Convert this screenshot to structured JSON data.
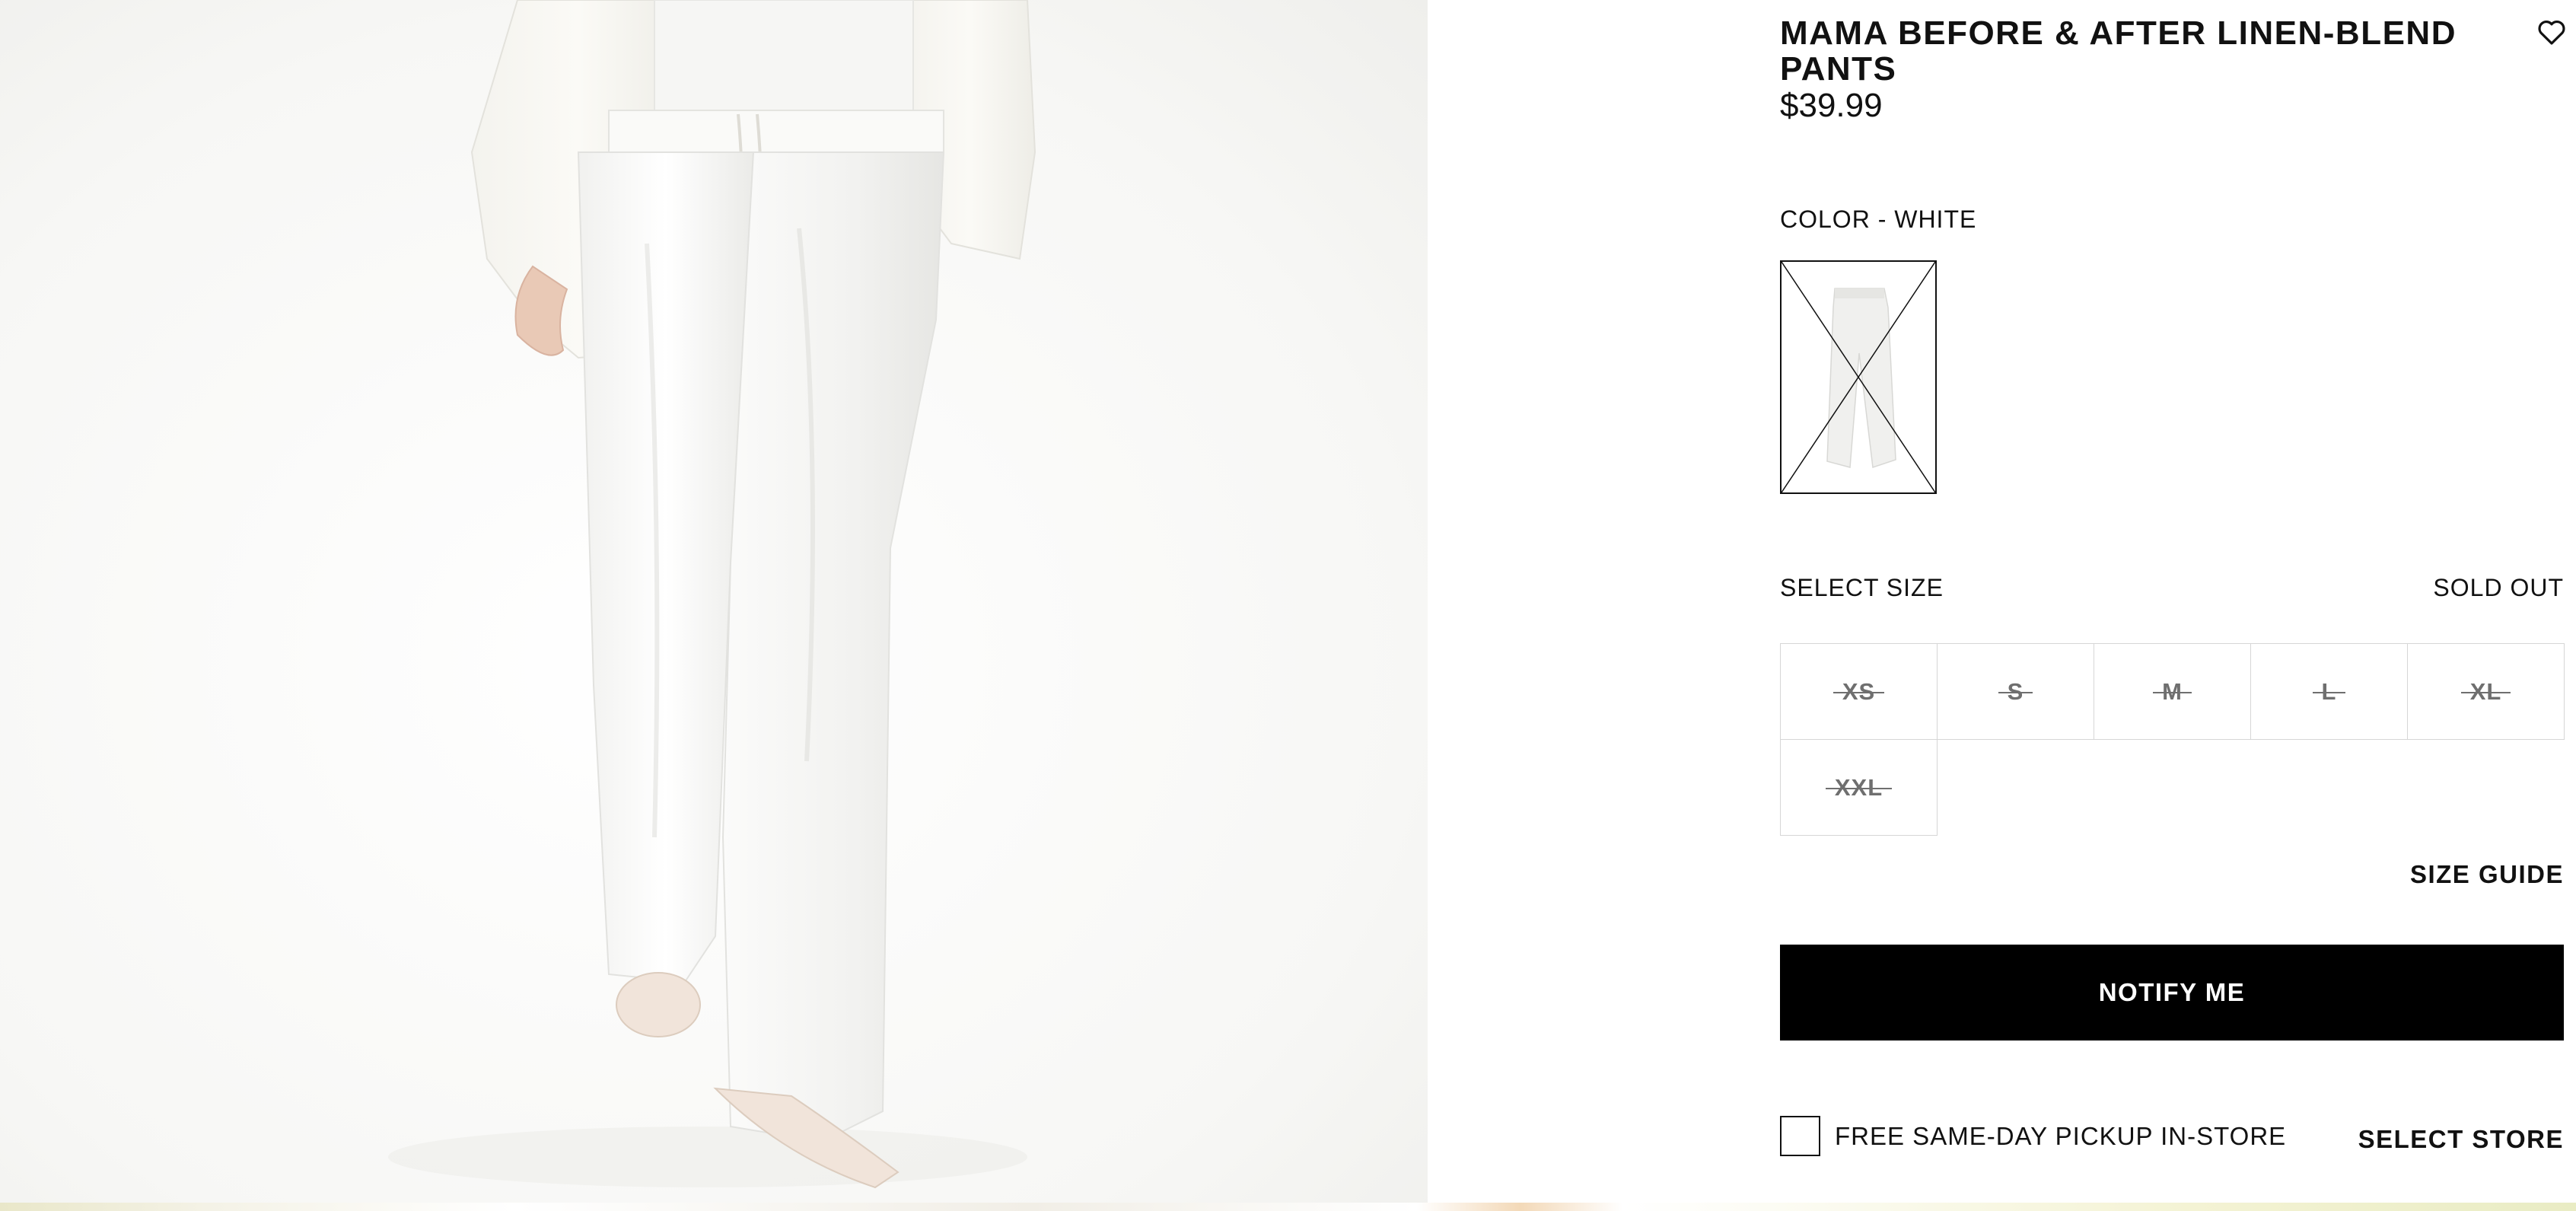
{
  "product": {
    "title": "MAMA BEFORE & AFTER LINEN-BLEND PANTS",
    "price": "$39.99"
  },
  "icons": {
    "wishlist": "heart-outline-icon"
  },
  "color": {
    "label": "COLOR - WHITE",
    "selected_swatch": "white"
  },
  "size": {
    "label": "SELECT SIZE",
    "status": "SOLD OUT",
    "options": [
      "XS",
      "S",
      "M",
      "L",
      "XL",
      "XXL"
    ],
    "guide_label": "SIZE GUIDE"
  },
  "actions": {
    "notify_label": "NOTIFY ME"
  },
  "pickup": {
    "label": "FREE SAME-DAY PICKUP IN-STORE",
    "checked": false,
    "store_label": "SELECT STORE"
  },
  "colors": {
    "button_bg": "#000000",
    "button_text": "#ffffff",
    "unavailable_size_text": "#6f6f6f",
    "border": "#d6d6d6"
  }
}
